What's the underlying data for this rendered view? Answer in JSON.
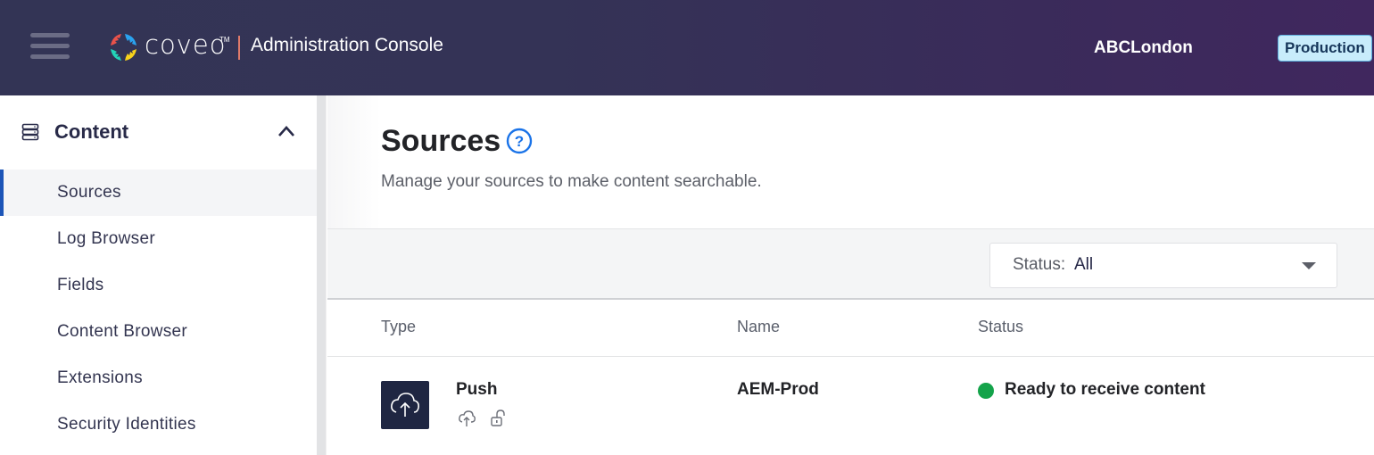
{
  "header": {
    "brand": "coveo",
    "trademark": "TM",
    "app_title": "Administration Console",
    "organization": "ABCLondon",
    "environment_badge": "Production",
    "colors": {
      "badge_bg": "#c8ecfb",
      "badge_text": "#16365a",
      "divider": "#e07a6a"
    },
    "logo_colors": [
      "#e9524a",
      "#2aa3ef",
      "#23d4b8",
      "#f7d21b"
    ]
  },
  "sidebar": {
    "section": {
      "title": "Content",
      "icon": "server-stack-icon",
      "expanded": true
    },
    "items": [
      {
        "label": "Sources",
        "active": true
      },
      {
        "label": "Log Browser",
        "active": false
      },
      {
        "label": "Fields",
        "active": false
      },
      {
        "label": "Content Browser",
        "active": false
      },
      {
        "label": "Extensions",
        "active": false
      },
      {
        "label": "Security Identities",
        "active": false
      }
    ],
    "accent": "#1c55b8"
  },
  "main": {
    "title": "Sources",
    "help_icon": "help-circle-icon",
    "description": "Manage your sources to make content searchable.",
    "filter": {
      "label": "Status:",
      "value": "All"
    },
    "table": {
      "columns": [
        "Type",
        "Name",
        "Status"
      ],
      "rows": [
        {
          "type": "Push",
          "type_icon": "cloud-upload-icon",
          "sub_icons": [
            "push-upload-icon",
            "unlocked-icon"
          ],
          "name": "AEM-Prod",
          "status": "Ready to receive content",
          "status_color": "#14a34a"
        }
      ]
    }
  }
}
